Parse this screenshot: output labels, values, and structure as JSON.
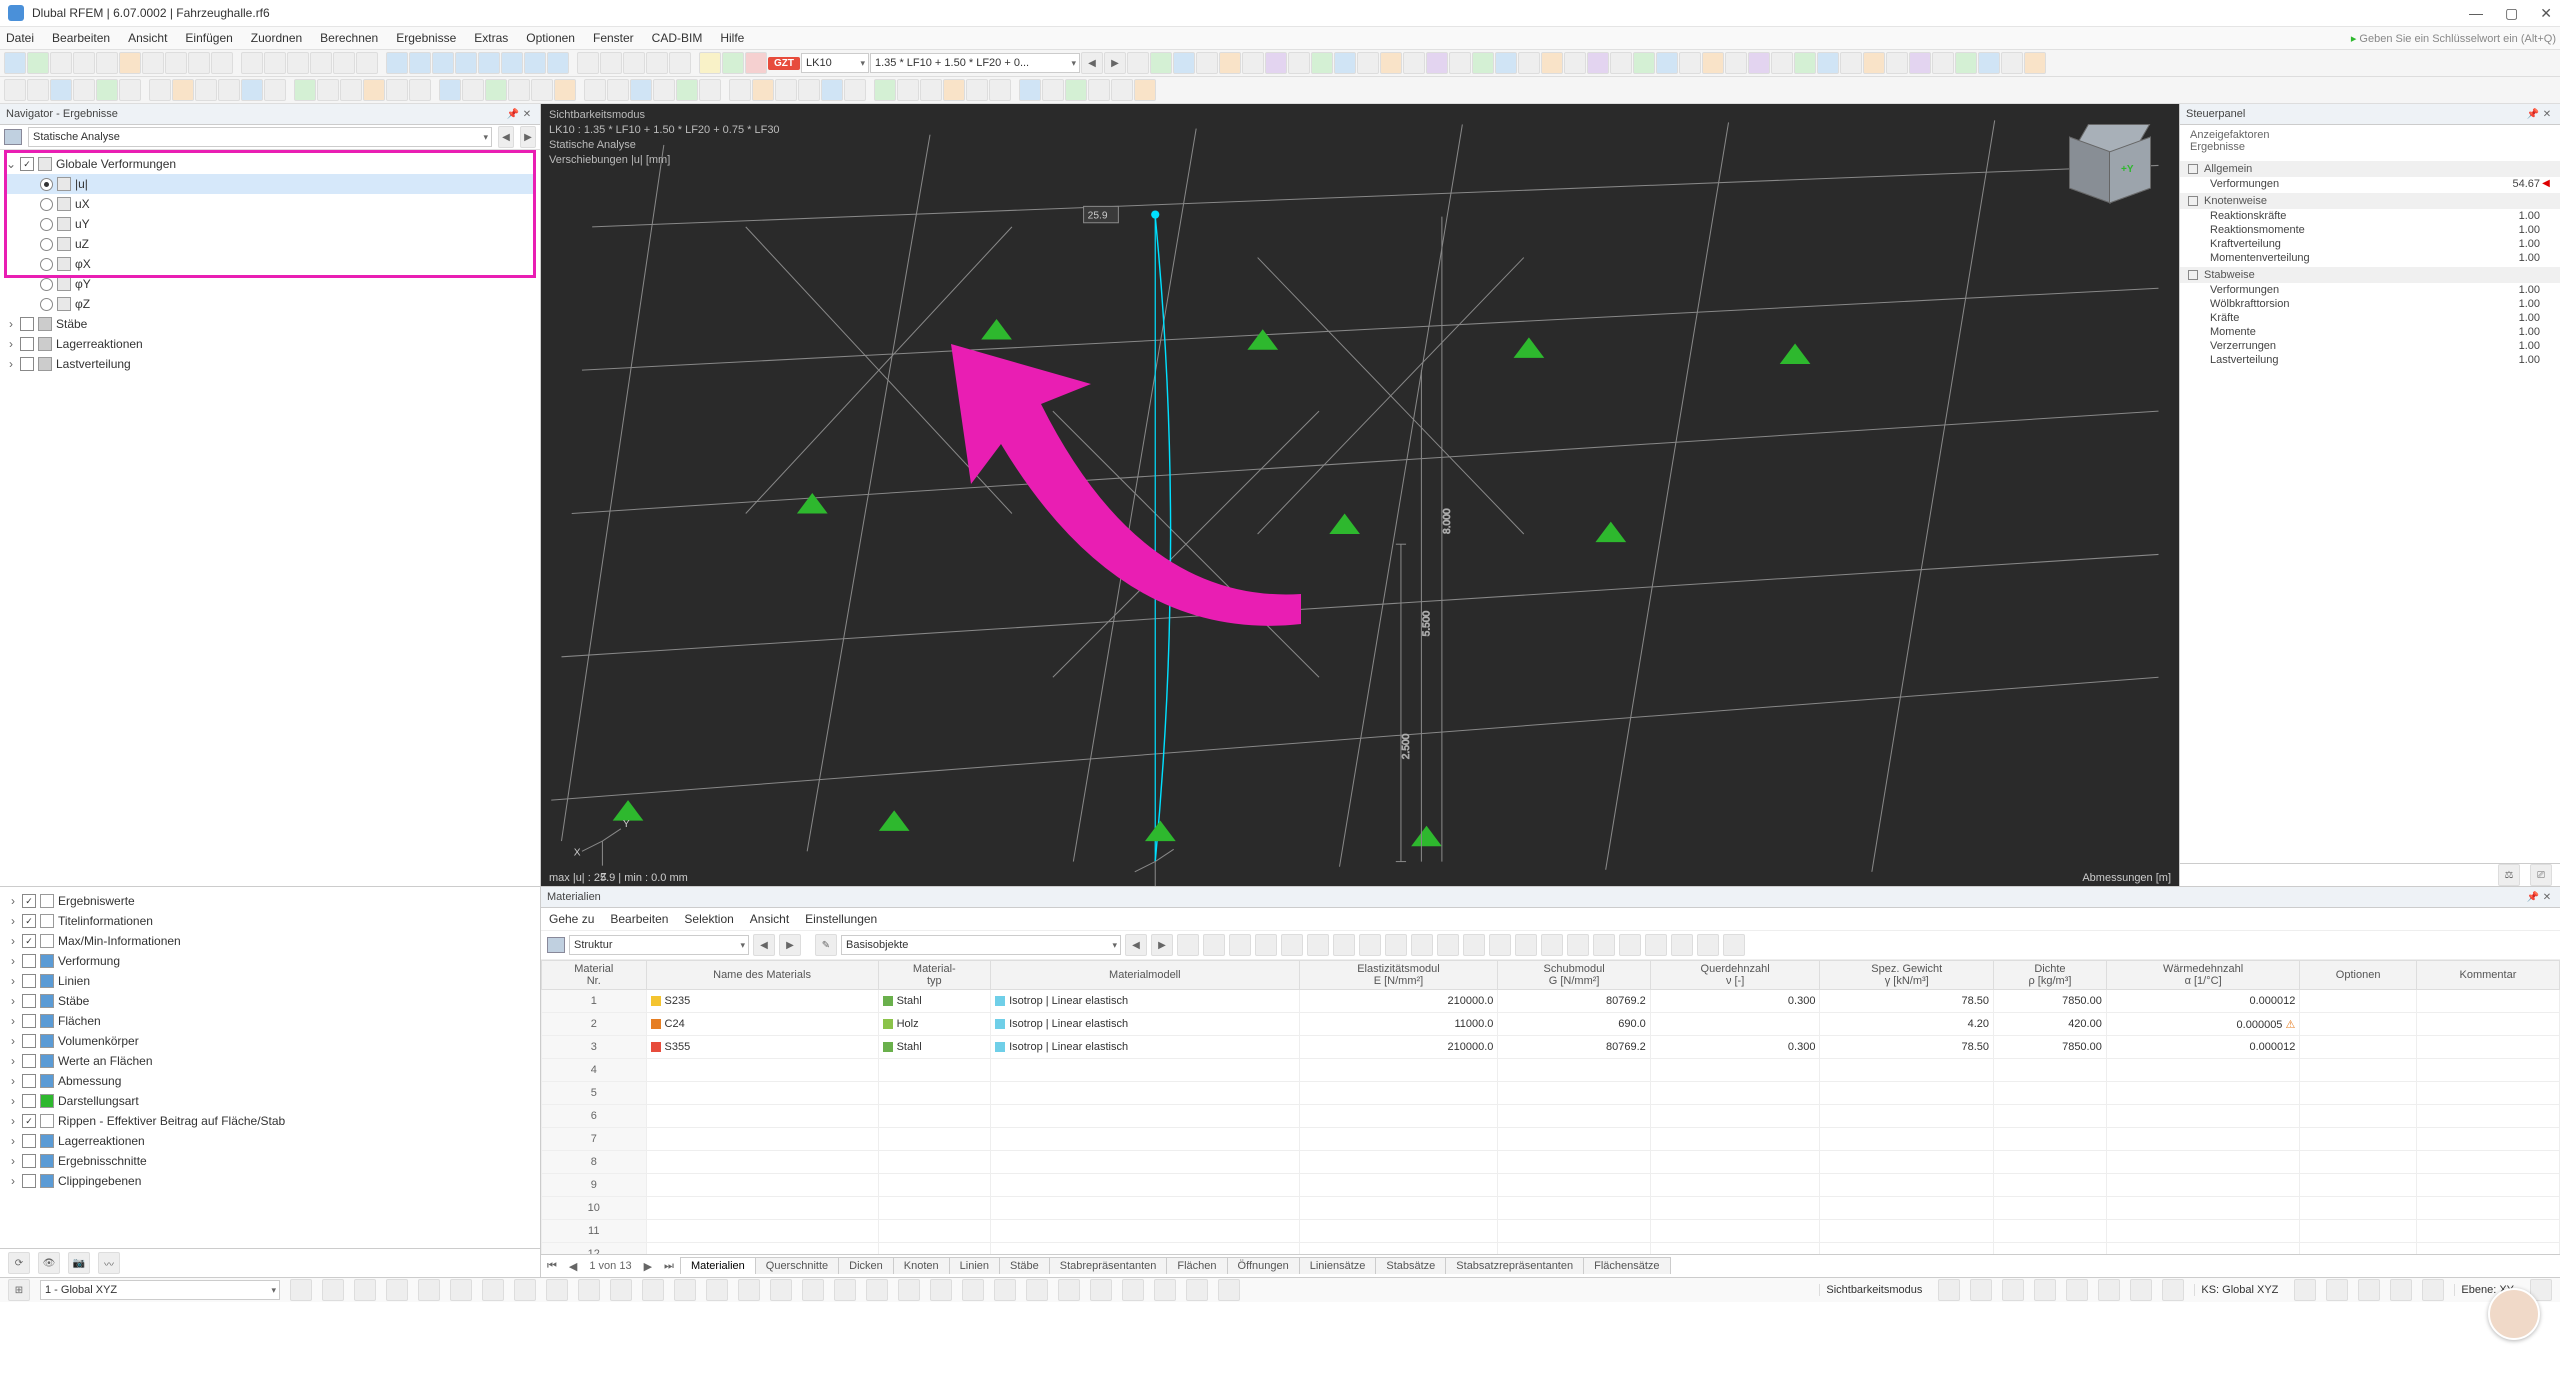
{
  "title": "Dlubal RFEM | 6.07.0002 | Fahrzeughalle.rf6",
  "menu": [
    "Datei",
    "Bearbeiten",
    "Ansicht",
    "Einfügen",
    "Zuordnen",
    "Berechnen",
    "Ergebnisse",
    "Extras",
    "Optionen",
    "Fenster",
    "CAD-BIM",
    "Hilfe"
  ],
  "menu_search_placeholder": "Geben Sie ein Schlüsselwort ein (Alt+Q)",
  "toolbar2": {
    "badge": "GZT",
    "lk": "LK10",
    "desc": "1.35 * LF10 + 1.50 * LF20 + 0..."
  },
  "navigator": {
    "title": "Navigator - Ergebnisse",
    "dropdown": "Statische Analyse",
    "root": "Globale Verformungen",
    "items": [
      "|u|",
      "uX",
      "uY",
      "uZ",
      "φX",
      "φY",
      "φZ"
    ],
    "extra": [
      "Stäbe",
      "Lagerreaktionen",
      "Lastverteilung"
    ]
  },
  "nav_bottom": [
    {
      "label": "Ergebniswerte",
      "checked": true
    },
    {
      "label": "Titelinformationen",
      "checked": true
    },
    {
      "label": "Max/Min-Informationen",
      "checked": true
    },
    {
      "label": "Verformung",
      "checked": false,
      "color": "#5b9bd5"
    },
    {
      "label": "Linien",
      "checked": false,
      "color": "#5b9bd5"
    },
    {
      "label": "Stäbe",
      "checked": false,
      "color": "#5b9bd5"
    },
    {
      "label": "Flächen",
      "checked": false,
      "color": "#5b9bd5"
    },
    {
      "label": "Volumenkörper",
      "checked": false,
      "color": "#5b9bd5"
    },
    {
      "label": "Werte an Flächen",
      "checked": false,
      "color": "#5b9bd5"
    },
    {
      "label": "Abmessung",
      "checked": false,
      "color": "#5b9bd5"
    },
    {
      "label": "Darstellungsart",
      "checked": false,
      "color": "#2eb82e"
    },
    {
      "label": "Rippen - Effektiver Beitrag auf Fläche/Stab",
      "checked": true
    },
    {
      "label": "Lagerreaktionen",
      "checked": false,
      "color": "#5b9bd5"
    },
    {
      "label": "Ergebnisschnitte",
      "checked": false,
      "color": "#5b9bd5"
    },
    {
      "label": "Clippingebenen",
      "checked": false,
      "color": "#5b9bd5"
    }
  ],
  "viewport": {
    "l1": "Sichtbarkeitsmodus",
    "l2": "LK10 : 1.35 * LF10 + 1.50 * LF20 + 0.75 * LF30",
    "l3": "Statische Analyse",
    "l4": "Verschiebungen |u| [mm]",
    "max": "max |u| : 25.9 | min : 0.0 mm",
    "dimlabel": "Abmessungen [m]",
    "tag": "25.9",
    "dims": [
      "2.500",
      "5.500",
      "8.000"
    ]
  },
  "steuer": {
    "title": "Steuerpanel",
    "sub1": "Anzeigefaktoren",
    "sub2": "Ergebnisse",
    "sections": [
      {
        "name": "Allgemein",
        "rows": [
          {
            "k": "Verformungen",
            "v": "54.67",
            "arr": true
          }
        ]
      },
      {
        "name": "Knotenweise",
        "rows": [
          {
            "k": "Reaktionskräfte",
            "v": "1.00"
          },
          {
            "k": "Reaktionsmomente",
            "v": "1.00"
          },
          {
            "k": "Kraftverteilung",
            "v": "1.00"
          },
          {
            "k": "Momentenverteilung",
            "v": "1.00"
          }
        ]
      },
      {
        "name": "Stabweise",
        "rows": [
          {
            "k": "Verformungen",
            "v": "1.00"
          },
          {
            "k": "Wölbkrafttorsion",
            "v": "1.00"
          },
          {
            "k": "Kräfte",
            "v": "1.00"
          },
          {
            "k": "Momente",
            "v": "1.00"
          },
          {
            "k": "Verzerrungen",
            "v": "1.00"
          },
          {
            "k": "Lastverteilung",
            "v": "1.00"
          }
        ]
      }
    ]
  },
  "materials": {
    "title": "Materialien",
    "menu": [
      "Gehe zu",
      "Bearbeiten",
      "Selektion",
      "Ansicht",
      "Einstellungen"
    ],
    "structsel": "Struktur",
    "basissel": "Basisobjekte",
    "headers": [
      "Material\nNr.",
      "Name des Materials",
      "Material-\ntyp",
      "Materialmodell",
      "Elastizitätsmodul\nE [N/mm²]",
      "Schubmodul\nG [N/mm²]",
      "Querdehnzahl\nν [-]",
      "Spez. Gewicht\nγ [kN/m³]",
      "Dichte\nρ [kg/m³]",
      "Wärmedehnzahl\nα [1/°C]",
      "Optionen",
      "Kommentar"
    ],
    "rows": [
      {
        "nr": "1",
        "name": "S235",
        "color": "#f4c430",
        "typ": "Stahl",
        "typc": "#6ab04c",
        "model": "Isotrop | Linear elastisch",
        "modc": "#6fcfe8",
        "E": "210000.0",
        "G": "80769.2",
        "nu": "0.300",
        "gamma": "78.50",
        "rho": "7850.00",
        "alpha": "0.000012"
      },
      {
        "nr": "2",
        "name": "C24",
        "color": "#e67e22",
        "typ": "Holz",
        "typc": "#8bc34a",
        "model": "Isotrop | Linear elastisch",
        "modc": "#6fcfe8",
        "E": "11000.0",
        "G": "690.0",
        "nu": "",
        "gamma": "4.20",
        "rho": "420.00",
        "alpha": "0.000005",
        "warn": true
      },
      {
        "nr": "3",
        "name": "S355",
        "color": "#e74c3c",
        "typ": "Stahl",
        "typc": "#6ab04c",
        "model": "Isotrop | Linear elastisch",
        "modc": "#6fcfe8",
        "E": "210000.0",
        "G": "80769.2",
        "nu": "0.300",
        "gamma": "78.50",
        "rho": "7850.00",
        "alpha": "0.000012"
      }
    ],
    "pager": "1 von 13",
    "tabs": [
      "Materialien",
      "Querschnitte",
      "Dicken",
      "Knoten",
      "Linien",
      "Stäbe",
      "Stabrepräsentanten",
      "Flächen",
      "Öffnungen",
      "Liniensätze",
      "Stabsätze",
      "Stabsatzrepräsentanten",
      "Flächensätze"
    ]
  },
  "status": {
    "coordsel": "1 - Global XYZ",
    "mode": "Sichtbarkeitsmodus",
    "ks": "KS: Global XYZ",
    "ebene": "Ebene: XY"
  }
}
